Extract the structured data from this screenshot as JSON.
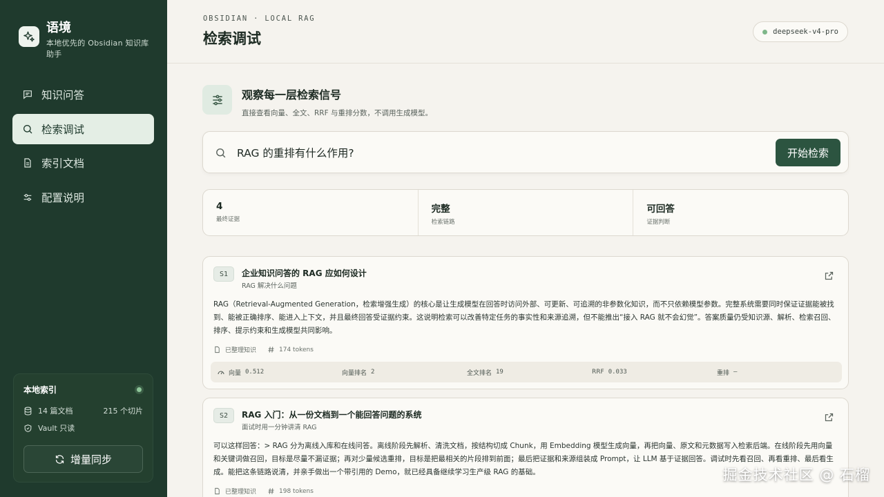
{
  "brand": {
    "name": "语境",
    "subtitle": "本地优先的 Obsidian 知识库助手"
  },
  "nav": {
    "items": [
      {
        "label": "知识问答",
        "icon": "chat-icon",
        "active": false
      },
      {
        "label": "检索调试",
        "icon": "search-icon",
        "active": true
      },
      {
        "label": "索引文档",
        "icon": "document-icon",
        "active": false
      },
      {
        "label": "配置说明",
        "icon": "settings-icon",
        "active": false
      }
    ]
  },
  "index_card": {
    "title": "本地索引",
    "docs": "14 篇文档",
    "chunks": "215 个切片",
    "vault": "Vault 只读",
    "sync_label": "增量同步"
  },
  "header": {
    "eyebrow": "OBSIDIAN · LOCAL RAG",
    "title": "检索调试",
    "model": "deepseek-v4-pro"
  },
  "section": {
    "title": "观察每一层检索信号",
    "subtitle": "直接查看向量、全文、RRF 与重排分数，不调用生成模型。"
  },
  "search": {
    "query": "RAG 的重排有什么作用?",
    "button_label": "开始检索"
  },
  "stats": [
    {
      "value": "4",
      "label": "最终证据"
    },
    {
      "value": "完整",
      "label": "检索链路"
    },
    {
      "value": "可回答",
      "label": "证据判断"
    }
  ],
  "results": [
    {
      "badge": "S1",
      "title": "企业知识问答的 RAG 应如何设计",
      "subtitle": "RAG 解决什么问题",
      "body": "RAG（Retrieval-Augmented Generation，检索增强生成）的核心是让生成模型在回答时访问外部、可更新、可追溯的非参数化知识，而不只依赖模型参数。完整系统需要同时保证证据能被找到、能被正确排序、能进入上下文，并且最终回答受证据约束。这说明检索可以改善特定任务的事实性和来源追溯，但不能推出“接入 RAG 就不会幻觉”。答案质量仍受知识源、解析、检索召回、排序、提示约束和生成模型共同影响。",
      "source": "已整理知识",
      "tokens": "174 tokens",
      "scores": {
        "vector_label": "向量",
        "vector": "0.512",
        "vector_rank_label": "向量排名",
        "vector_rank": "2",
        "fulltext_rank_label": "全文排名",
        "fulltext_rank": "19",
        "rrf_label": "RRF",
        "rrf": "0.033",
        "rerank_label": "重排",
        "rerank": "—"
      }
    },
    {
      "badge": "S2",
      "title": "RAG 入门：从一份文档到一个能回答问题的系统",
      "subtitle": "面试时用一分钟讲清 RAG",
      "body": "可以这样回答：> RAG 分为离线入库和在线问答。离线阶段先解析、清洗文档，按结构切成 Chunk，用 Embedding 模型生成向量，再把向量、原文和元数据写入检索后端。在线阶段先用向量和关键词做召回，目标是尽量不漏证据；再对少量候选重排，目标是把最相关的片段排到前面；最后把证据和来源组装成 Prompt，让 LLM 基于证据回答。调试时先看召回、再看重排、最后看生成。能把这条链路说清，并亲手做出一个带引用的 Demo，就已经具备继续学习生产级 RAG 的基础。",
      "source": "已整理知识",
      "tokens": "198 tokens"
    }
  ],
  "watermark": "掘金技术社区 @ 石榴",
  "colors": {
    "sidebar": "#1f3a2d",
    "accent": "#2c5440",
    "background": "#f5f3ee"
  }
}
